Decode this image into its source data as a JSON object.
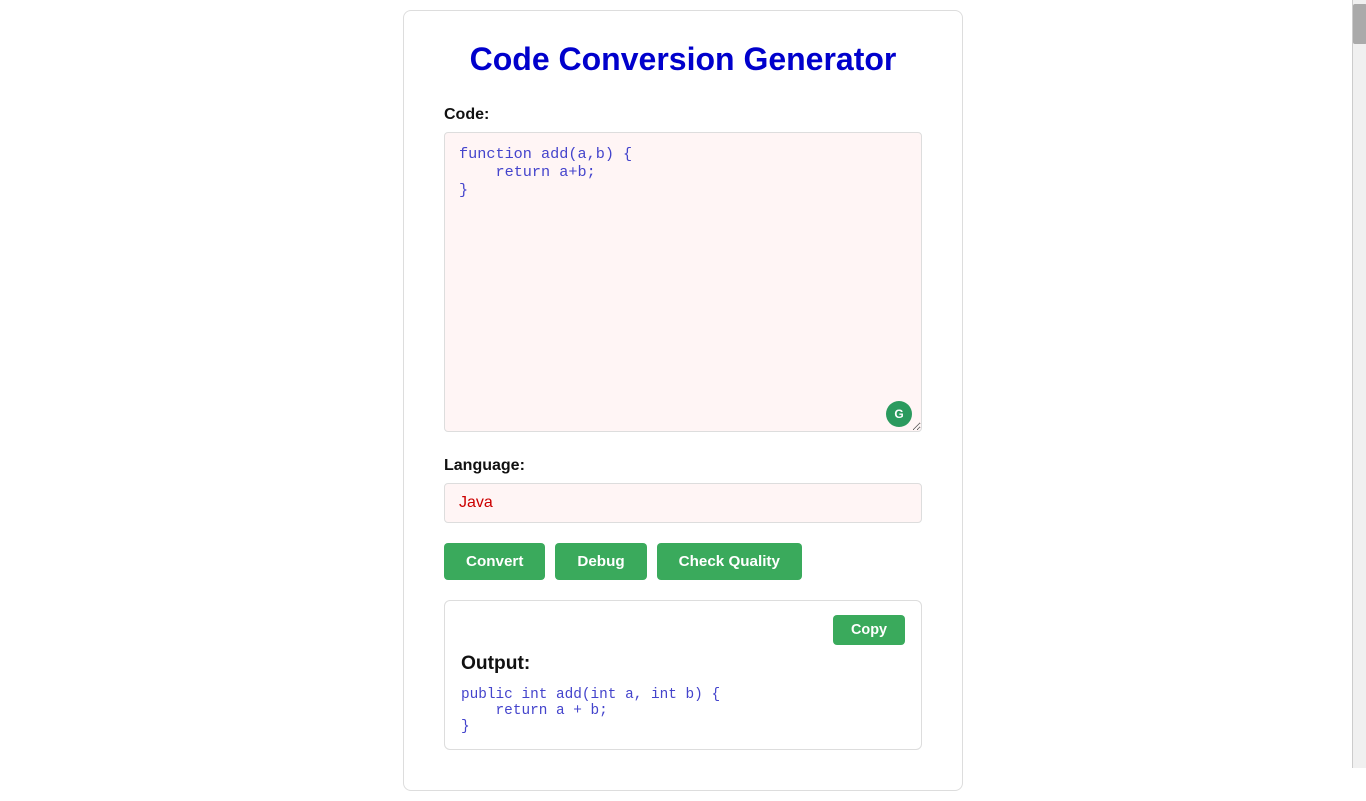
{
  "page": {
    "title": "Code Conversion Generator"
  },
  "labels": {
    "code": "Code:",
    "language": "Language:",
    "output": "Output:"
  },
  "code_input": {
    "value": "function add(a,b) {\n    return a+b;\n}",
    "placeholder": ""
  },
  "language_input": {
    "value": "Java",
    "placeholder": "Language"
  },
  "buttons": {
    "convert": "Convert",
    "debug": "Debug",
    "check_quality": "Check Quality",
    "copy": "Copy"
  },
  "output_code": "public int add(int a, int b) {\n    return a + b;\n}",
  "icons": {
    "grammarly": "G",
    "scrollbar": "scrollbar"
  }
}
